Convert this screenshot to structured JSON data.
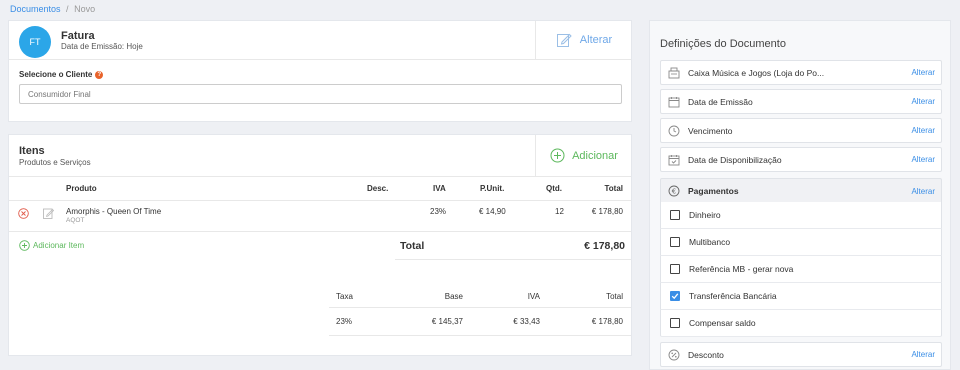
{
  "breadcrumb": {
    "parent": "Documentos",
    "separator": "/",
    "current": "Novo"
  },
  "document": {
    "avatar": "FT",
    "type": "Fatura",
    "subtitle": "Data de Emissão: Hoje",
    "change_label": "Alterar",
    "client_label": "Selecione o Cliente",
    "client_placeholder": "Consumidor Final"
  },
  "items": {
    "title": "Itens",
    "subtitle": "Produtos e Serviços",
    "add_label": "Adicionar",
    "columns": {
      "product": "Produto",
      "desc": "Desc.",
      "vat": "IVA",
      "unit": "P.Unit.",
      "qty": "Qtd.",
      "total": "Total"
    },
    "rows": [
      {
        "name": "Amorphis - Queen Of Time",
        "code": "AQOT",
        "desc": "",
        "vat": "23%",
        "unit": "€ 14,90",
        "qty": "12",
        "total": "€ 178,80"
      }
    ],
    "add_item_label": "Adicionar Item",
    "total_label": "Total",
    "total_value": "€ 178,80",
    "tax_columns": {
      "rate": "Taxa",
      "base": "Base",
      "vat": "IVA",
      "total": "Total"
    },
    "tax_rows": [
      {
        "rate": "23%",
        "base": "€ 145,37",
        "vat": "€ 33,43",
        "total": "€ 178,80"
      }
    ]
  },
  "settings": {
    "title": "Definições do Documento",
    "change_label": "Alterar",
    "entries": [
      {
        "label": "Caixa Música e Jogos (Loja do Po...",
        "icon": "register-icon"
      },
      {
        "label": "Data de Emissão",
        "icon": "calendar-icon"
      },
      {
        "label": "Vencimento",
        "icon": "clock-icon"
      },
      {
        "label": "Data de Disponibilização",
        "icon": "calendar-check-icon"
      }
    ],
    "payments": {
      "title": "Pagamentos",
      "options": [
        {
          "label": "Dinheiro",
          "checked": false
        },
        {
          "label": "Multibanco",
          "checked": false
        },
        {
          "label": "Referência MB - gerar nova",
          "checked": false
        },
        {
          "label": "Transferência Bancária",
          "checked": true
        },
        {
          "label": "Compensar saldo",
          "checked": false
        }
      ]
    },
    "discount": {
      "label": "Desconto"
    }
  },
  "colors": {
    "accent": "#3a8ee6",
    "green": "#5cb85c",
    "avatar": "#2ba6e8",
    "danger": "#e05a4a"
  }
}
